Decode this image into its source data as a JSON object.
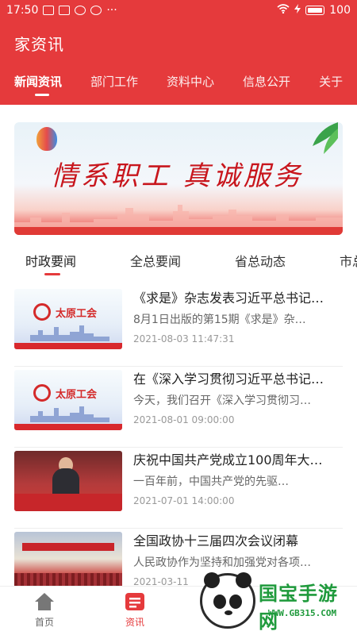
{
  "status_bar": {
    "time": "17:50",
    "more": "···",
    "battery": "100"
  },
  "app": {
    "title": "家资讯"
  },
  "top_nav": [
    {
      "label": "新闻资讯"
    },
    {
      "label": "部门工作"
    },
    {
      "label": "资料中心"
    },
    {
      "label": "信息公开"
    },
    {
      "label": "关于"
    }
  ],
  "banner": {
    "slogan": "情系职工 真诚服务"
  },
  "sub_tabs": [
    {
      "label": "时政要闻"
    },
    {
      "label": "全总要闻"
    },
    {
      "label": "省总动态"
    },
    {
      "label": "市总"
    }
  ],
  "news": [
    {
      "title": "《求是》杂志发表习近平总书记…",
      "summary": "8月1日出版的第15期《求是》杂…",
      "date": "2021-08-03 11:47:31",
      "thumb_text": "太原工会"
    },
    {
      "title": "在《深入学习贯彻习近平总书记…",
      "summary": "今天，我们召开《深入学习贯彻习…",
      "date": "2021-08-01 09:00:00",
      "thumb_text": "太原工会"
    },
    {
      "title": "庆祝中国共产党成立100周年大…",
      "summary": "一百年前，中国共产党的先驱…",
      "date": "2021-07-01 14:00:00"
    },
    {
      "title": "全国政协十三届四次会议闭幕",
      "summary": "人民政协作为坚持和加强党对各项…",
      "date": "2021-03-11"
    }
  ],
  "bottom_nav": [
    {
      "label": "首页",
      "icon": "home-icon"
    },
    {
      "label": "资讯",
      "icon": "news-icon"
    }
  ],
  "watermark": {
    "title": "国宝手游网",
    "url": "WWW.GB315.COM"
  },
  "colors": {
    "brand_red": "#e53a3c",
    "watermark_green": "#1f9a3c"
  }
}
